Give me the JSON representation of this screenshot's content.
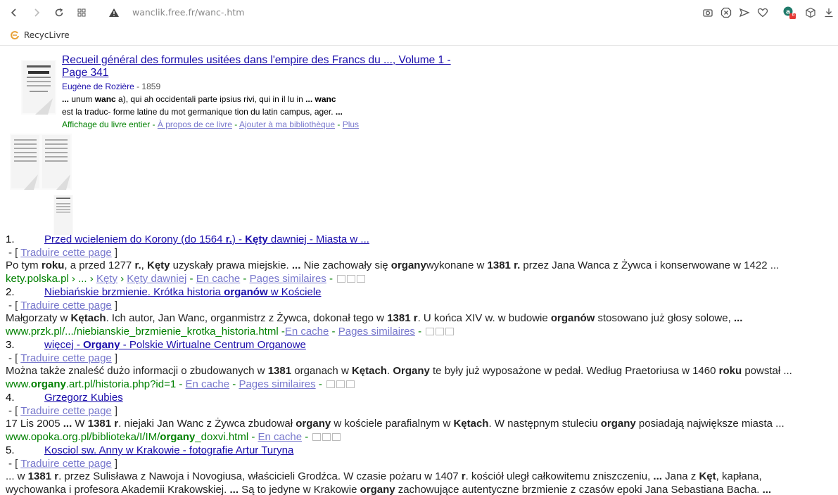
{
  "browser": {
    "url": "wanclik.free.fr/wanc-.htm",
    "bookmark": "RecycLivre",
    "badge_count": "6"
  },
  "book": {
    "title": "Recueil général des formules usitées dans l'empire des Francs du ..., Volume 1 - Page 341",
    "author": "Eugène de Rozière",
    "year": "- 1859",
    "snippet_line1": "... unum wanc a), qui ah occidentali parte ipsius rivi, qui in il lu in ... wanc",
    "snippet_line2": "est la traduc- forme latine du mot germanique tion du latin campus, ager. ...",
    "links_prefix": "Affichage du livre entier - ",
    "link_about": "À propos de ce livre",
    "link_add": "Ajouter à ma bibliothèque",
    "link_more": "Plus"
  },
  "common": {
    "translate": "Traduire cette page",
    "cache": "En cache",
    "similar": "Pages similaires"
  },
  "results": [
    {
      "number": "1.",
      "title_html": "Przed wcieleniem do Korony (do 1564 <b>r.</b>) - <b>Kęty</b> dawniej - Miasta w ...",
      "snippet_html": "Po tym <b>roku</b>, a przed 1277 <b>r.</b>, <b>Kęty</b> uzyskały prawa miejskie. <b>...</b> Nie zachowały się <b>organy</b>wykonane w <b>1381</b> <b>r.</b> przez Jana Wanca z Żywca i konserwowane w 1422 ...",
      "url": "kety.polska.pl › ... › ",
      "url_links": [
        "Kęty",
        "Kęty dawniej"
      ],
      "similar": true
    },
    {
      "number": "2.",
      "title_html": "Niebiańskie brzmienie. Krótka historia <b>organów</b> w Kościele",
      "snippet_html": "Małgorzaty w <b>Kętach</b>. Ich autor, Jan Wanc, organmistrz z Żywca, dokonał tego w <b>1381</b> <b>r</b>. U końca XIV w. w budowie <b>organów</b> stosowano już głosy solowe, <b>...</b>",
      "url": "www.przk.pl/.../niebianskie_brzmienie_krotka_historia.html -",
      "url_links": [],
      "similar": true
    },
    {
      "number": "3.",
      "title_html": "więcej - <b>Organy</b> - Polskie Wirtualne Centrum Organowe",
      "snippet_html": "Można także znaleść dużo informacji o zbudowanych w <b>1381</b> organach w <b>Kętach</b>. <b>Organy</b> te były już wyposażone w pedał. Według Praetoriusa w 1460 <b>roku</b> powstał ...",
      "url_html": "www.<b>organy</b>.art.pl/historia.php?id=1 - ",
      "url_links": [],
      "similar": true
    },
    {
      "number": "4.",
      "title_html": "Grzegorz Kubies",
      "snippet_html": "17 Lis 2005 <b>...</b> W <b>1381</b> <b>r</b>. niejaki Jan Wanc z Żywca zbudował <b>organy</b> w kościele parafialnym w <b>Kętach</b>. W następnym stuleciu <b>organy</b> posiadają największe miasta ...",
      "url_html": "www.opoka.org.pl/biblioteka/I/IM/<b>organy</b>_doxvi.html - ",
      "url_links": [],
      "similar": false
    },
    {
      "number": "5.",
      "title_html": "Kosciol sw. Anny w Krakowie - fotografie Artur Turyna",
      "snippet_html": "... w <b>1381</b> <b>r</b>. przez Sulisława z Nawoja i Novogiusa, właścicieli Grodźca. W czasie pożaru w 1407 <b>r</b>. kościół uległ całkowitemu zniszczeniu, <b>...</b> Jana z <b>Kęt</b>, kapłana,",
      "snippet2_html": "wychowanka i profesora Akademii Krakowskiej. <b>...</b> Są to jedyne w Krakowie <b>organy</b> zachowujące autentyczne brzmienie z czasów epoki Jana Sebastiana Bacha. <b>...</b>",
      "url_links": [],
      "similar": false
    }
  ]
}
